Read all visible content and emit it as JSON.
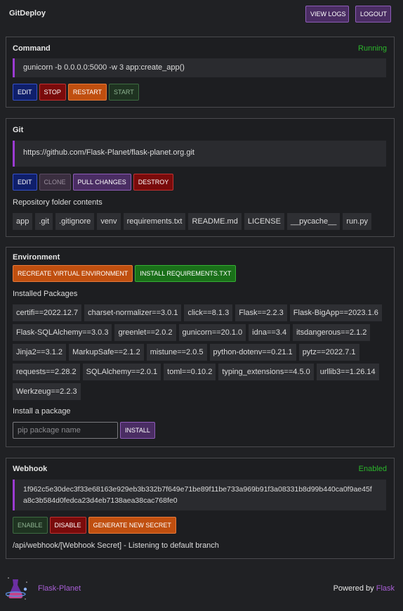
{
  "app": {
    "title": "GitDeploy",
    "view_logs": "VIEW LOGS",
    "logout": "LOGOUT"
  },
  "command": {
    "title": "Command",
    "status": "Running",
    "value": "gunicorn -b 0.0.0.0:5000 -w 3 app:create_app()",
    "buttons": {
      "edit": "EDIT",
      "stop": "STOP",
      "restart": "RESTART",
      "start": "START"
    }
  },
  "git": {
    "title": "Git",
    "url": "https://github.com/Flask-Planet/flask-planet.org.git",
    "buttons": {
      "edit": "EDIT",
      "clone": "CLONE",
      "pull": "PULL CHANGES",
      "destroy": "DESTROY"
    },
    "folder_label": "Repository folder contents",
    "files": [
      "app",
      ".git",
      ".gitignore",
      "venv",
      "requirements.txt",
      "README.md",
      "LICENSE",
      "__pycache__",
      "run.py"
    ]
  },
  "environment": {
    "title": "Environment",
    "buttons": {
      "recreate": "RECREATE VIRTUAL ENVIRONMENT",
      "install_req": "INSTALL REQUIREMENTS.TXT",
      "install": "INSTALL"
    },
    "packages_label": "Installed Packages",
    "packages": [
      "certifi==2022.12.7",
      "charset-normalizer==3.0.1",
      "click==8.1.3",
      "Flask==2.2.3",
      "Flask-BigApp==2023.1.6",
      "Flask-SQLAlchemy==3.0.3",
      "greenlet==2.0.2",
      "gunicorn==20.1.0",
      "idna==3.4",
      "itsdangerous==2.1.2",
      "Jinja2==3.1.2",
      "MarkupSafe==2.1.2",
      "mistune==2.0.5",
      "python-dotenv==0.21.1",
      "pytz==2022.7.1",
      "requests==2.28.2",
      "SQLAlchemy==2.0.1",
      "toml==0.10.2",
      "typing_extensions==4.5.0",
      "urllib3==1.26.14",
      "Werkzeug==2.2.3"
    ],
    "install_label": "Install a package",
    "pip_placeholder": "pip package name"
  },
  "webhook": {
    "title": "Webhook",
    "status": "Enabled",
    "secret_line1": "1f962c5e30dec3f33e68163e929eb3b332b7f649e71be89f11be733a969b91f3a08331b8d99b440ca0f9ae45f",
    "secret_line2": "a8c3b584d0fedca23d4eb7138aea38cac768fe0",
    "buttons": {
      "enable": "ENABLE",
      "disable": "DISABLE",
      "generate": "GENERATE NEW SECRET"
    },
    "info": "/api/webhook/[Webhook Secret] - Listening to default branch"
  },
  "footer": {
    "name": "Flask-Planet",
    "powered_by": "Powered by",
    "flask_link": "Flask"
  },
  "colors": {
    "background": "#202124",
    "accent": "#9b3bd1",
    "status_green": "#2bb52b"
  }
}
